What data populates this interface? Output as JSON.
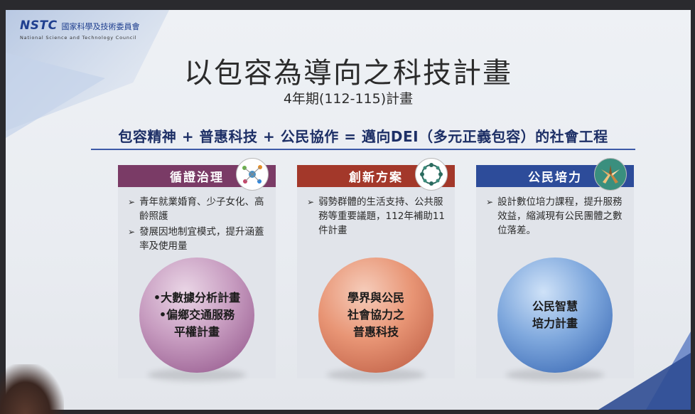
{
  "logo": {
    "mark": "NSTC",
    "name_cn": "國家科學及技術委員會",
    "name_en": "National Science and Technology Council"
  },
  "slide": {
    "title": "以包容為導向之科技計畫",
    "subtitle": "4年期(112-115)計畫",
    "equation": "包容精神 + 普惠科技 + 公民協作 = 邁向DEI（多元正義包容）的社會工程"
  },
  "cards": [
    {
      "header": "循證治理",
      "header_color": "#7a3b66",
      "icon": "data-network-icon",
      "bullets": [
        "青年就業婚育、少子女化、高齡照護",
        "發展因地制宜模式，提升涵蓋率及使用量"
      ],
      "sphere_lines": [
        "•大數據分析計畫",
        "•偏鄉交通服務",
        "平權計畫"
      ]
    },
    {
      "header": "創新方案",
      "header_color": "#a3382a",
      "icon": "people-circle-icon",
      "bullets": [
        "弱勢群體的生活支持、公共服務等重要議題，112年補助11件計畫"
      ],
      "sphere_lines": [
        "學界與公民",
        "社會協力之",
        "普惠科技"
      ]
    },
    {
      "header": "公民培力",
      "header_color": "#2d4c9a",
      "icon": "hands-together-icon",
      "bullets": [
        "設計數位培力課程，提升服務效益，縮減現有公民團體之數位落差。"
      ],
      "sphere_lines": [
        "公民智慧",
        "培力計畫"
      ]
    }
  ]
}
